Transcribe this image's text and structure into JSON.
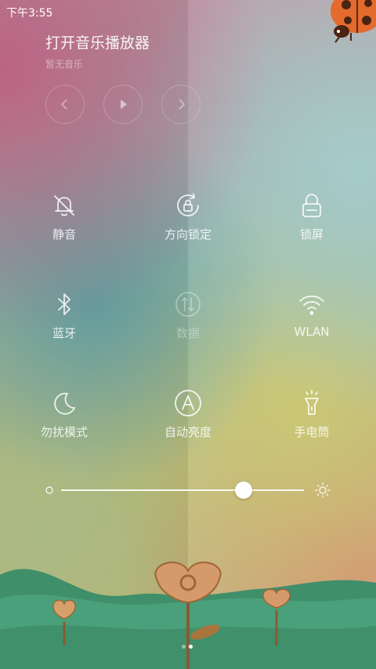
{
  "status_bar": {
    "time": "下午3:55"
  },
  "music": {
    "title": "打开音乐播放器",
    "subtitle": "暂无音乐"
  },
  "controls": {
    "prev_icon": "chevron-left-icon",
    "play_icon": "play-icon",
    "next_icon": "chevron-right-icon"
  },
  "toggles": [
    {
      "label": "静音",
      "icon": "bell-off-icon",
      "enabled": true
    },
    {
      "label": "方向锁定",
      "icon": "rotation-lock-icon",
      "enabled": true
    },
    {
      "label": "锁屏",
      "icon": "lock-icon",
      "enabled": true
    },
    {
      "label": "蓝牙",
      "icon": "bluetooth-icon",
      "enabled": true
    },
    {
      "label": "数据",
      "icon": "mobile-data-icon",
      "enabled": false
    },
    {
      "label": "WLAN",
      "icon": "wifi-icon",
      "enabled": true
    },
    {
      "label": "勿扰模式",
      "icon": "moon-icon",
      "enabled": true
    },
    {
      "label": "自动亮度",
      "icon": "auto-brightness-icon",
      "enabled": true
    },
    {
      "label": "手电筒",
      "icon": "flashlight-icon",
      "enabled": true
    }
  ],
  "brightness": {
    "level": 0.75
  },
  "pager": {
    "pages": 2,
    "current": 2
  }
}
